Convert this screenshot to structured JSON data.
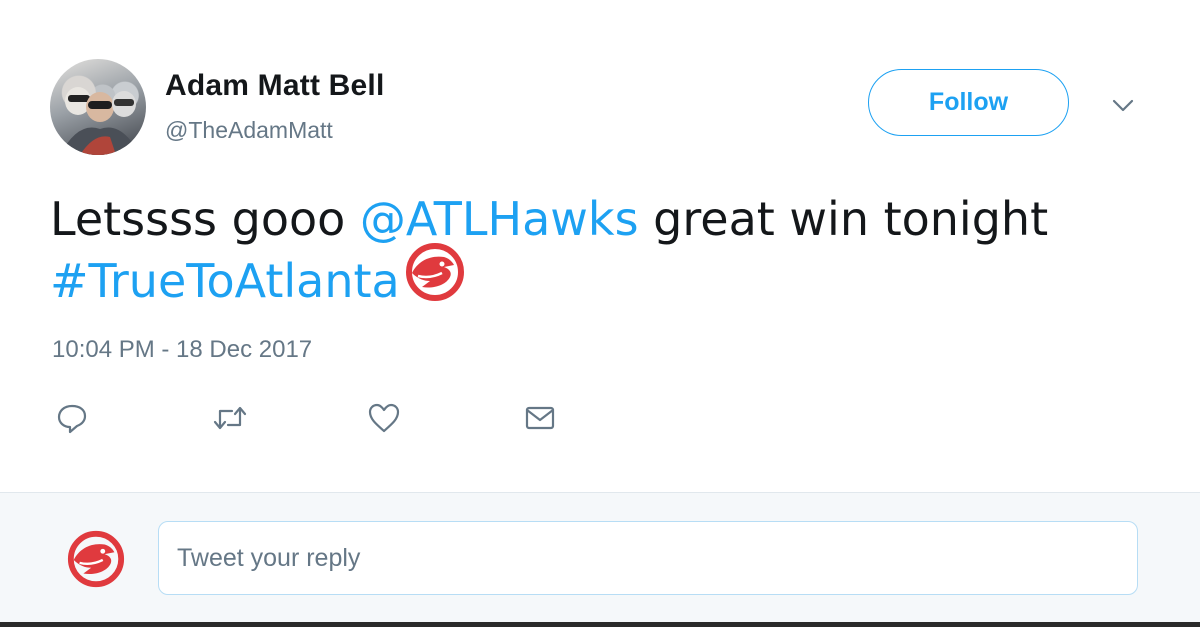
{
  "user": {
    "name": "Adam Matt Bell",
    "handle": "@TheAdamMatt"
  },
  "follow_label": "Follow",
  "tweet": {
    "text_prefix": "Letssss gooo ",
    "mention": "@ATLHawks",
    "text_middle": " great win tonight",
    "hashtag": "#TrueToAtlanta",
    "emoji_icon": "atlanta-hawks-logo-icon",
    "timestamp": "10:04 PM - 18 Dec 2017"
  },
  "actions": [
    "reply-icon",
    "retweet-icon",
    "like-icon",
    "direct-message-icon"
  ],
  "reply": {
    "placeholder": "Tweet your reply"
  },
  "colors": {
    "accent": "#1da1f2",
    "text": "#14171a",
    "muted": "#657786",
    "hawks_red": "#e03a3e",
    "reply_bar_bg": "#f5f8fa"
  }
}
